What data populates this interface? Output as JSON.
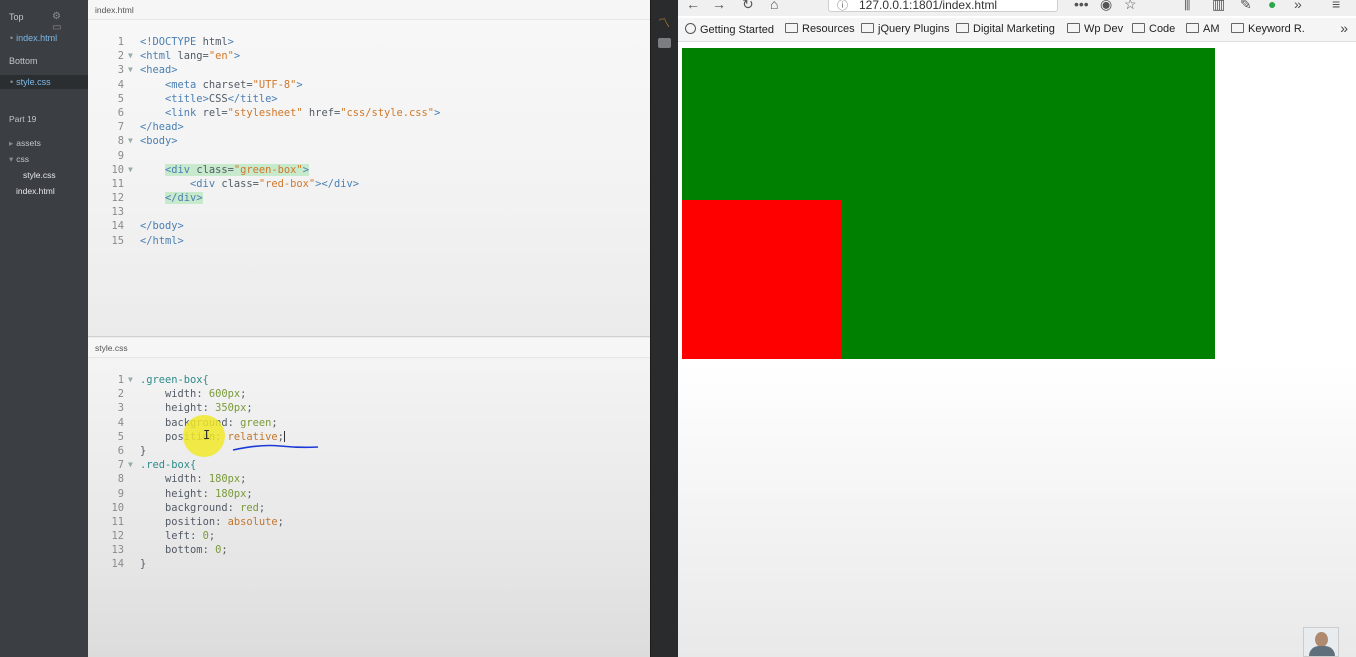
{
  "sidebar": {
    "top_label": "Top",
    "top_files": [
      "index.html"
    ],
    "bottom_label": "Bottom",
    "bottom_files": [
      "style.css"
    ],
    "project_label": "Part 19",
    "tree": [
      "assets",
      "css",
      "style.css",
      "index.html"
    ]
  },
  "editor": {
    "top_pane": {
      "filename": "index.html",
      "lines": [
        {
          "n": "1",
          "fold": "",
          "html": "&lt;!DOCTYPE html&gt;"
        },
        {
          "n": "2",
          "fold": "▼",
          "html": "&lt;html lang=\"en\"&gt;"
        },
        {
          "n": "3",
          "fold": "▼",
          "html": "&lt;head&gt;"
        },
        {
          "n": "4",
          "fold": "",
          "html": "    &lt;meta charset=\"UTF-8\"&gt;"
        },
        {
          "n": "5",
          "fold": "",
          "html": "    &lt;title&gt;CSS&lt;/title&gt;"
        },
        {
          "n": "6",
          "fold": "",
          "html": "    &lt;link rel=\"stylesheet\" href=\"css/style.css\"&gt;"
        },
        {
          "n": "7",
          "fold": "",
          "html": "&lt;/head&gt;"
        },
        {
          "n": "8",
          "fold": "▼",
          "html": "&lt;body&gt;"
        },
        {
          "n": "9",
          "fold": "",
          "html": ""
        },
        {
          "n": "10",
          "fold": "▼",
          "html": "    &lt;div class=\"green-box\"&gt;"
        },
        {
          "n": "11",
          "fold": "",
          "html": "        &lt;div class=\"red-box\"&gt;&lt;/div&gt;"
        },
        {
          "n": "12",
          "fold": "",
          "html": "    &lt;/div&gt;"
        },
        {
          "n": "13",
          "fold": "",
          "html": ""
        },
        {
          "n": "14",
          "fold": "",
          "html": "&lt;/body&gt;"
        },
        {
          "n": "15",
          "fold": "",
          "html": "&lt;/html&gt;"
        }
      ]
    },
    "bottom_pane": {
      "filename": "style.css",
      "lines": [
        {
          "n": "1",
          "fold": "▼",
          "html": ".green-box{"
        },
        {
          "n": "2",
          "fold": "",
          "html": "    width: 600px;"
        },
        {
          "n": "3",
          "fold": "",
          "html": "    height: 350px;"
        },
        {
          "n": "4",
          "fold": "",
          "html": "    background: green;"
        },
        {
          "n": "5",
          "fold": "",
          "html": "    position: relative;"
        },
        {
          "n": "6",
          "fold": "",
          "html": "}"
        },
        {
          "n": "7",
          "fold": "▼",
          "html": ".red-box{"
        },
        {
          "n": "8",
          "fold": "",
          "html": "    width: 180px;"
        },
        {
          "n": "9",
          "fold": "",
          "html": "    height: 180px;"
        },
        {
          "n": "10",
          "fold": "",
          "html": "    background: red;"
        },
        {
          "n": "11",
          "fold": "",
          "html": "    position: absolute;"
        },
        {
          "n": "12",
          "fold": "",
          "html": "    left: 0;"
        },
        {
          "n": "13",
          "fold": "",
          "html": "    bottom: 0;"
        },
        {
          "n": "14",
          "fold": "",
          "html": "}"
        }
      ]
    }
  },
  "browser": {
    "url": "127.0.0.1:1801/index.html",
    "bookmarks": [
      "Getting Started",
      "Resources",
      "jQuery Plugins",
      "Digital Marketing",
      "Wp Dev",
      "Code",
      "AM",
      "Keyword R."
    ],
    "green_color": "#008000",
    "red_color": "#ff0000"
  }
}
